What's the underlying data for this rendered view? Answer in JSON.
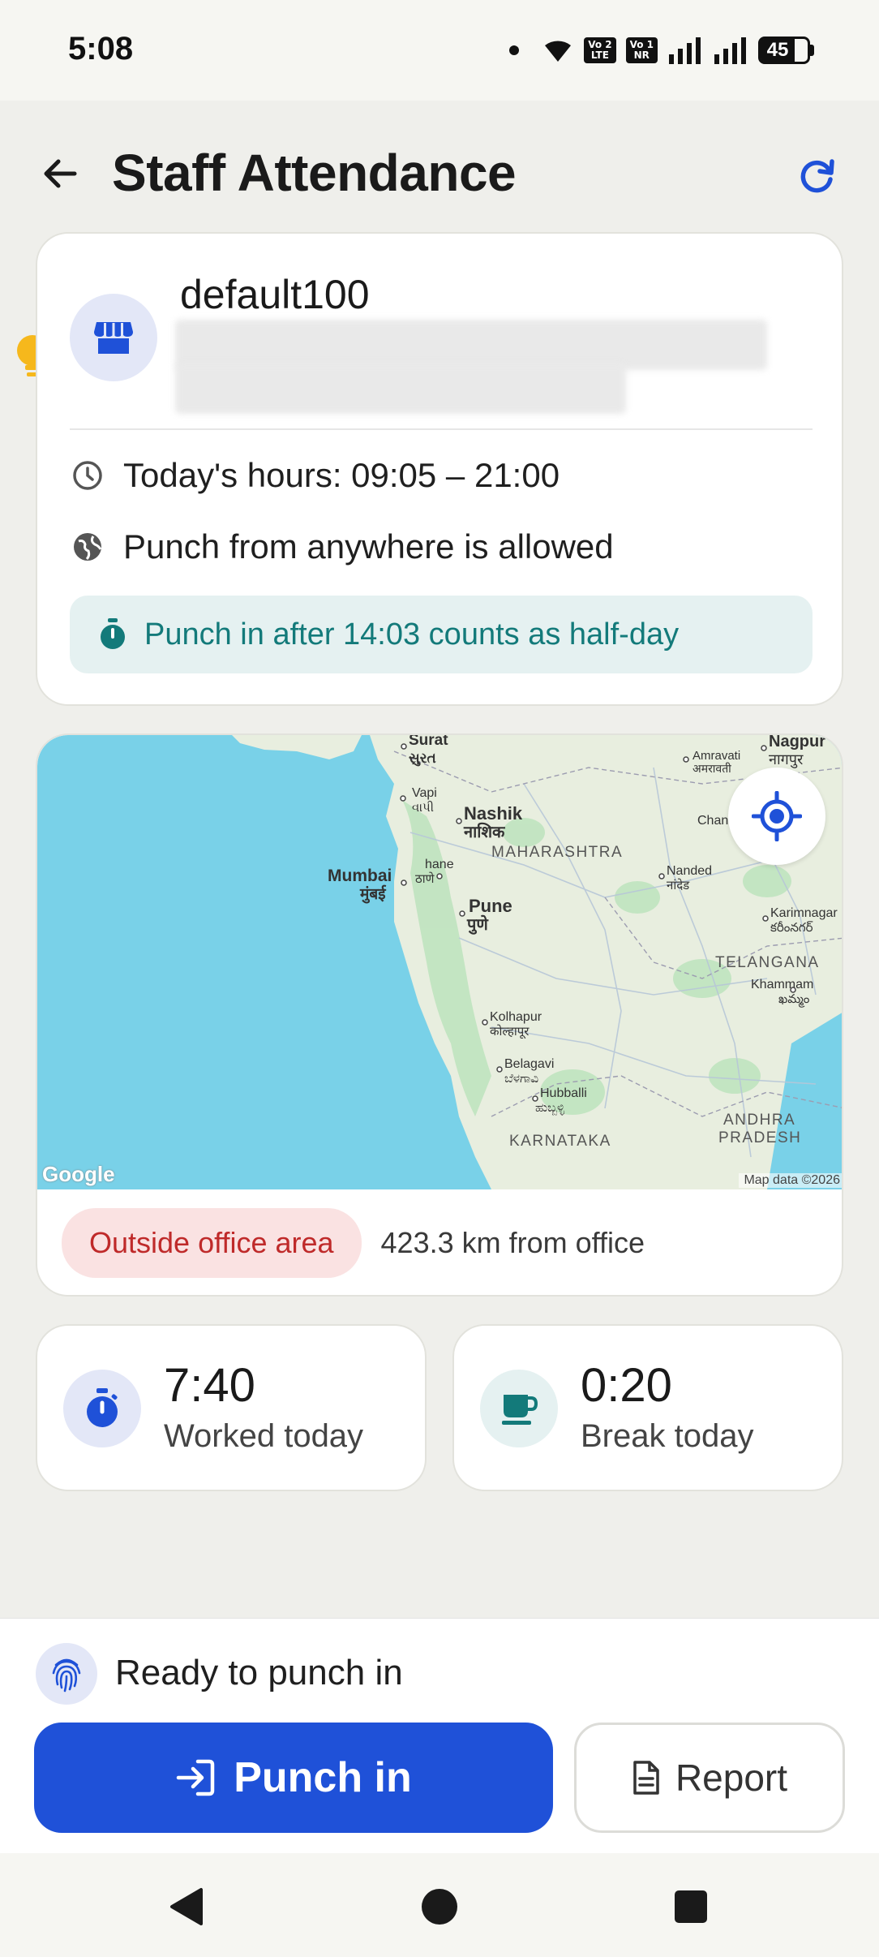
{
  "status_bar": {
    "time": "5:08",
    "volte1": "Vo 2\nLTE",
    "volte2": "Vo 1\nNR",
    "battery": "45"
  },
  "header": {
    "title": "Staff Attendance"
  },
  "store": {
    "name": "default100",
    "hours": "Today's hours: 09:05 – 21:00",
    "punch_policy": "Punch from anywhere is allowed",
    "halfday_note": "Punch in after 14:03 counts as half-day"
  },
  "map": {
    "labels": {
      "surat": "Surat",
      "surat_gu": "સુરત",
      "vapi": "Vapi",
      "vapi_gu": "વાપી",
      "nashik": "Nashik",
      "nashik_mr": "नाशिक",
      "maharashtra": "MAHARASHTRA",
      "mumbai": "Mumbai",
      "mumbai_mr": "मुंबई",
      "thane": "hane",
      "thane_mr": "ठाणे",
      "pune": "Pune",
      "pune_mr": "पुणे",
      "nanded": "Nanded",
      "nanded_mr": "नांदेड",
      "nagpur": "Nagpur",
      "nagpur_mr": "नागपुर",
      "amravati": "Amravati",
      "amravati_mr": "अमरावती",
      "chan": "Chan",
      "karimnagar": "Karimnagar",
      "karimnagar_te": "కరీంనగర్",
      "telangana": "TELANGANA",
      "khammam": "Khammam",
      "khammam_te": "ఖమ్మం",
      "kolhapur": "Kolhapur",
      "kolhapur_mr": "कोल्हापूर",
      "belagavi": "Belagavi",
      "belagavi_kn": "ಬೆಳಗಾವಿ",
      "hubballi": "Hubballi",
      "hubballi_kn": "ಹುಬ್ಬಳ್ಳಿ",
      "karnataka": "KARNATAKA",
      "andhra": "ANDHRA",
      "pradesh": "PRADESH"
    },
    "google_logo": "Google",
    "map_data": "Map data ©2026",
    "status_badge": "Outside office area",
    "distance": "423.3 km from office"
  },
  "stats": {
    "worked": {
      "value": "7:40",
      "label": "Worked today"
    },
    "break": {
      "value": "0:20",
      "label": "Break today"
    }
  },
  "bottom": {
    "ready_text": "Ready to punch in",
    "punch_label": "Punch in",
    "report_label": "Report"
  },
  "colors": {
    "primary": "#1f51d8",
    "teal": "#137a7a",
    "danger": "#bf2a2a",
    "sea": "#79d1e8",
    "land": "#e8eedf"
  }
}
